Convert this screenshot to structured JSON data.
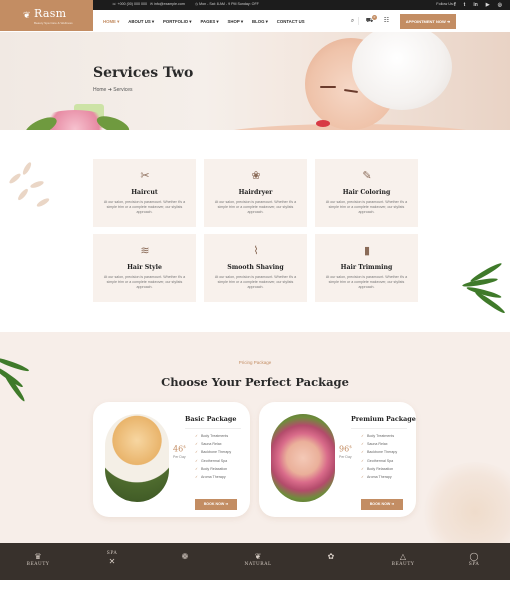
{
  "topbar": {
    "phone": "+000 (00) 000 000",
    "email": "info@example.com",
    "hours": "Mon - Sat: 8 AM - 9 PM Sunday: OFF",
    "follow": "Follow Us:",
    "socials": [
      "f",
      "t",
      "in",
      "▶",
      "◎"
    ]
  },
  "logo": {
    "name": "Rasm",
    "tagline": "Beauty Spa Care & Wellness"
  },
  "nav": {
    "items": [
      "HOME ▾",
      "ABOUT US ▾",
      "PORTFOLIO ▾",
      "PAGES ▾",
      "SHOP ▾",
      "BLOG ▾",
      "CONTACT US"
    ],
    "cart_count": "0",
    "appointment": "APPOINTMENT NOW ➜"
  },
  "hero": {
    "title": "Services Two",
    "breadcrumb": "Home ➜ Services"
  },
  "services": [
    {
      "title": "Haircut",
      "icon": "scissors-icon",
      "glyph": "✂",
      "desc": "At our salon, precision is paramount. Whether it's a simple trim or a complete makeover, our stylists approach."
    },
    {
      "title": "Hairdryer",
      "icon": "hairdryer-icon",
      "glyph": "❀",
      "desc": "At our salon, precision is paramount. Whether it's a simple trim or a complete makeover, our stylists approach."
    },
    {
      "title": "Hair Coloring",
      "icon": "hair-coloring-icon",
      "glyph": "✎",
      "desc": "At our salon, precision is paramount. Whether it's a simple trim or a complete makeover, our stylists approach."
    },
    {
      "title": "Hair Style",
      "icon": "comb-icon",
      "glyph": "≋",
      "desc": "At our salon, precision is paramount. Whether it's a simple trim or a complete makeover, our stylists approach."
    },
    {
      "title": "Smooth Shaving",
      "icon": "razor-icon",
      "glyph": "⌇",
      "desc": "At our salon, precision is paramount. Whether it's a simple trim or a complete makeover, our stylists approach."
    },
    {
      "title": "Hair Trimming",
      "icon": "trimmer-icon",
      "glyph": "▮",
      "desc": "At our salon, precision is paramount. Whether it's a simple trim or a complete makeover, our stylists approach."
    }
  ],
  "pricing": {
    "subtitle": "Pricing Package",
    "heading": "Choose Your Perfect Package",
    "packages": [
      {
        "name": "Basic Package",
        "price": "46",
        "currency": "$",
        "per": "Per Day",
        "features": [
          "Body Treatments",
          "Sauna Relax",
          "Backbone Therapy",
          "Geothermal Spa",
          "Body Relaxation",
          "Aroma Therapy"
        ],
        "button": "BOOK NOW ➜"
      },
      {
        "name": "Premium Package",
        "price": "96",
        "currency": "$",
        "per": "Per Day",
        "features": [
          "Body Treatments",
          "Sauna Relax",
          "Backbone Therapy",
          "Geothermal Spa",
          "Body Relaxation",
          "Aroma Therapy"
        ],
        "button": "BOOK NOW ➜"
      }
    ]
  },
  "brands": [
    {
      "glyph": "♛",
      "text": "BEAUTY"
    },
    {
      "glyph": "✕",
      "text": "SPA"
    },
    {
      "glyph": "❁",
      "text": ""
    },
    {
      "glyph": "❦",
      "text": "NATURAL"
    },
    {
      "glyph": "✿",
      "text": ""
    },
    {
      "glyph": "△",
      "text": "BEAUTY"
    },
    {
      "glyph": "◯",
      "text": "SPA"
    }
  ],
  "colors": {
    "accent": "#c38d63",
    "dark": "#1c1c1c",
    "brand_strip": "#38312c",
    "card_bg": "#f8f1ec",
    "section_bg": "#f7eee9"
  }
}
